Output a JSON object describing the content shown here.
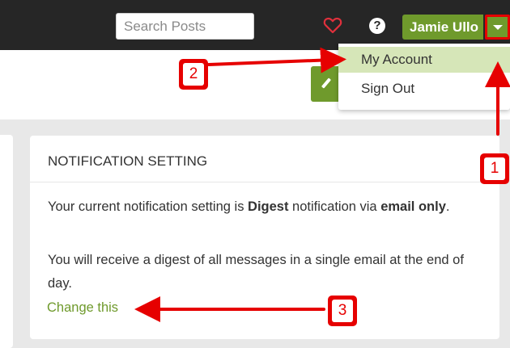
{
  "header": {
    "search_placeholder": "Search Posts",
    "help_symbol": "?",
    "user_name": "Jamie Ullo"
  },
  "dropdown": {
    "items": [
      {
        "label": "My Account"
      },
      {
        "label": "Sign Out"
      }
    ]
  },
  "card": {
    "title": "NOTIFICATION SETTING",
    "line1_a": "Your current notification setting is ",
    "line1_b": "Digest",
    "line1_c": " notification via ",
    "line1_d": "email only",
    "line1_e": ".",
    "line2": "You will receive a digest of all messages in a single email at the end of day.",
    "link": "Change this"
  },
  "annotations": {
    "step1": "1",
    "step2": "2",
    "step3": "3"
  },
  "colors": {
    "topbar": "#262626",
    "accent_green": "#6f9a2c",
    "highlight_green": "#d6e6b8",
    "annotation_red": "#e60000",
    "page_grey": "#e8e8e8"
  },
  "icons": {
    "heart": "heart-icon",
    "help": "help-icon",
    "caret": "caret-down-icon",
    "pencil": "pencil-icon"
  }
}
